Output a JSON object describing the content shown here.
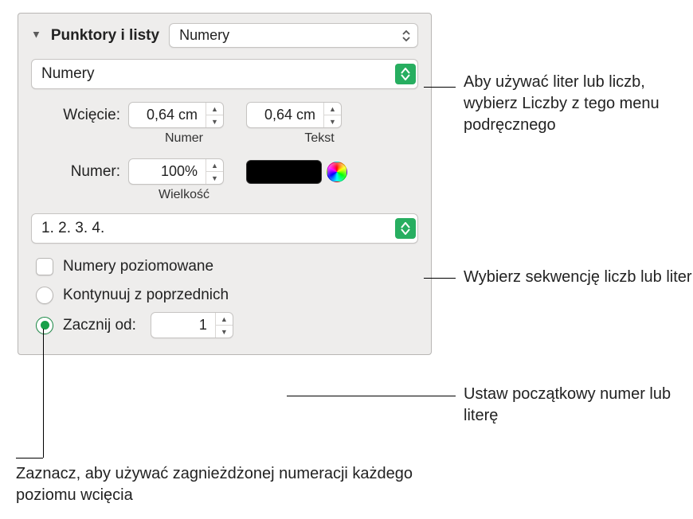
{
  "header": {
    "title": "Punktory i listy",
    "style_menu_value": "Numery"
  },
  "type_menu_value": "Numery",
  "indent": {
    "label": "Wcięcie:",
    "number_value": "0,64 cm",
    "number_caption": "Numer",
    "text_value": "0,64 cm",
    "text_caption": "Tekst"
  },
  "number_size": {
    "label": "Numer:",
    "value": "100%",
    "caption": "Wielkość"
  },
  "sequence_menu_value": "1. 2. 3. 4.",
  "tiered_checkbox_label": "Numery poziomowane",
  "radio_continue_label": "Kontynuuj z poprzednich",
  "radio_start_label": "Zacznij od:",
  "start_from_value": "1",
  "callouts": {
    "type": "Aby używać liter lub liczb, wybierz Liczby z tego menu podręcznego",
    "sequence": "Wybierz sekwencję liczb lub liter",
    "start": "Ustaw początkowy numer lub literę",
    "tiered": "Zaznacz, aby używać zagnieżdżonej numeracji każdego poziomu wcięcia"
  }
}
